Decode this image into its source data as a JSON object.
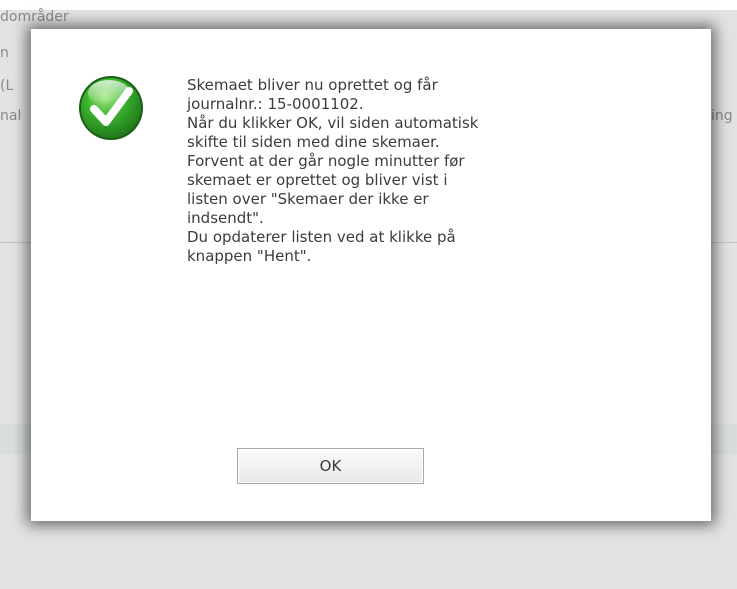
{
  "background": {
    "heading_fragment": "dområder",
    "left_fragments": [
      "n",
      "(L",
      "nal"
    ],
    "right_fragment": "ing og re"
  },
  "dialog": {
    "icon": "check-circle-icon",
    "icon_color": "#2fa02f",
    "message_lines": [
      "Skemaet bliver nu oprettet og får",
      "journalnr.: 15-0001102.",
      "Når du klikker OK, vil siden automatisk",
      "skifte til siden med dine skemaer.",
      "Forvent at der går nogle minutter før",
      "skemaet er oprettet og bliver vist i",
      "listen over \"Skemaer der ikke er",
      "indsendt\".",
      "Du opdaterer listen ved at klikke på",
      "knappen \"Hent\"."
    ],
    "ok_label": "OK"
  }
}
